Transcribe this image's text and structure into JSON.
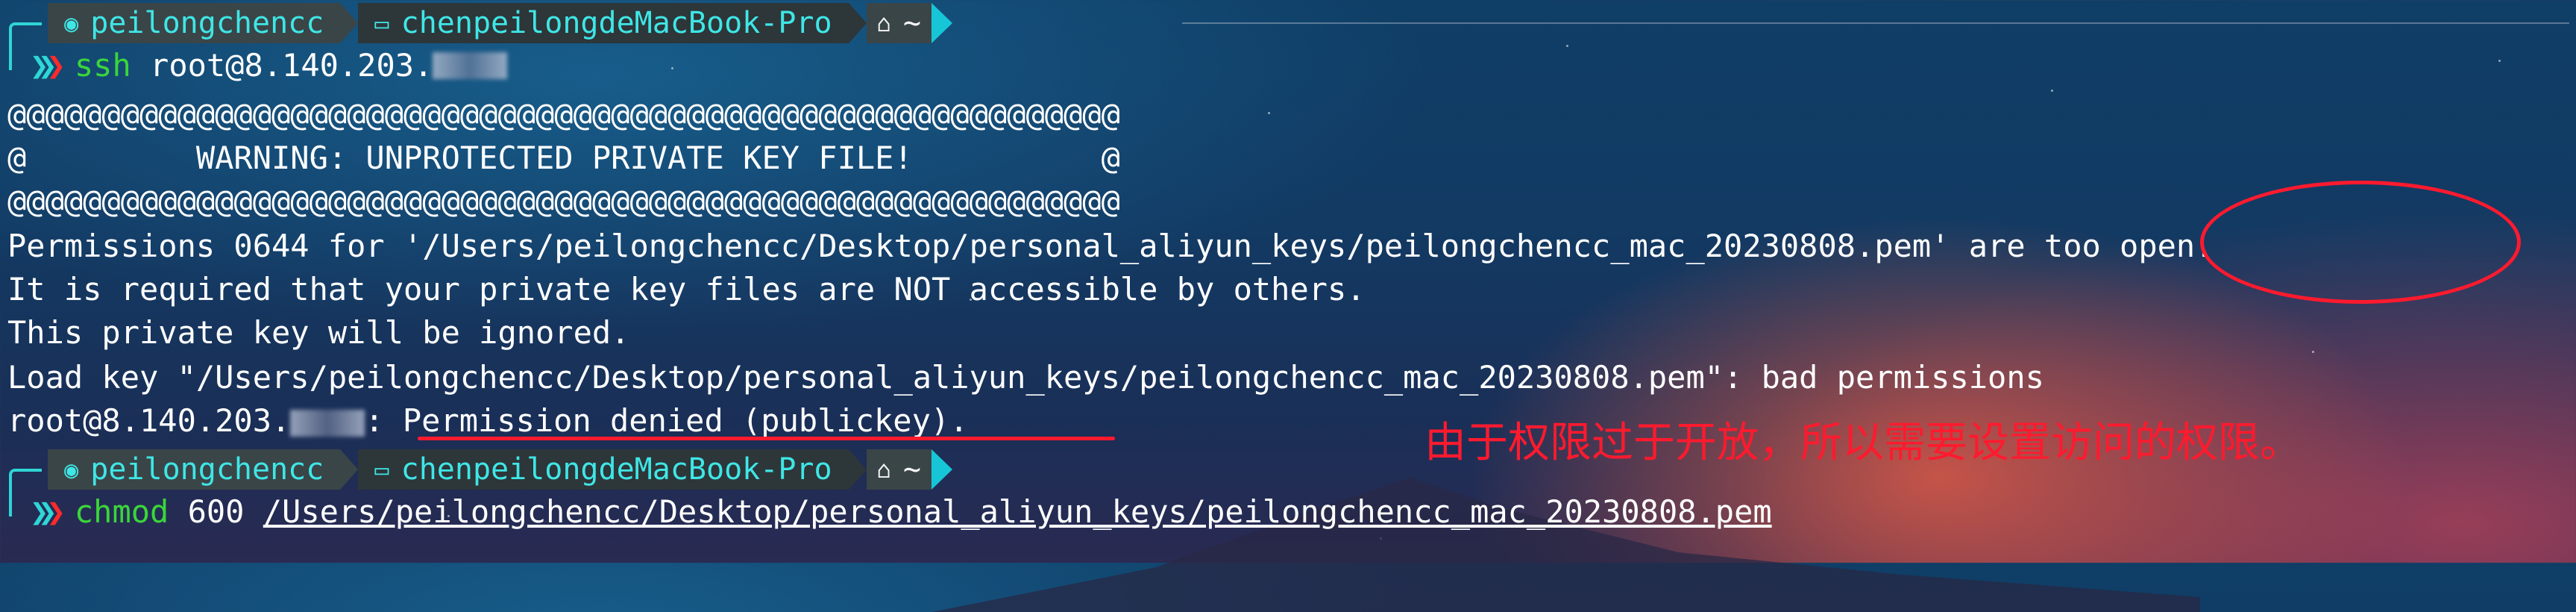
{
  "prompt": {
    "user_icon": "user-circle-icon",
    "user": "peilongchencc",
    "host_icon": "monitor-icon",
    "host": "chenpeilongdeMacBook-Pro",
    "home_icon": "home-icon",
    "dir": "~"
  },
  "commands": [
    {
      "cmd": "ssh",
      "args": "root@8.140.203."
    },
    {
      "cmd": "chmod",
      "args": "600",
      "path": "/Users/peilongchencc/Desktop/personal_aliyun_keys/peilongchencc_mac_20230808.pem"
    }
  ],
  "output": {
    "line1": "@@@@@@@@@@@@@@@@@@@@@@@@@@@@@@@@@@@@@@@@@@@@@@@@@@@@@@@@@@@",
    "line2": "@         WARNING: UNPROTECTED PRIVATE KEY FILE!          @",
    "line3": "@@@@@@@@@@@@@@@@@@@@@@@@@@@@@@@@@@@@@@@@@@@@@@@@@@@@@@@@@@@",
    "line4": "Permissions 0644 for '/Users/peilongchencc/Desktop/personal_aliyun_keys/peilongchencc_mac_20230808.pem' are too open.",
    "line5": "It is required that your private key files are NOT accessible by others.",
    "line6": "This private key will be ignored.",
    "line7": "Load key \"/Users/peilongchencc/Desktop/personal_aliyun_keys/peilongchencc_mac_20230808.pem\": bad permissions",
    "line8_prefix": "root@8.140.203.",
    "line8_suffix": ": Permission denied (publickey)."
  },
  "annotation": "由于权限过于开放，所以需要设置访问的权限。",
  "colors": {
    "accent_cyan": "#2fd6d6",
    "command_green": "#3ad63a",
    "annotation_red": "#ff1a2e"
  }
}
